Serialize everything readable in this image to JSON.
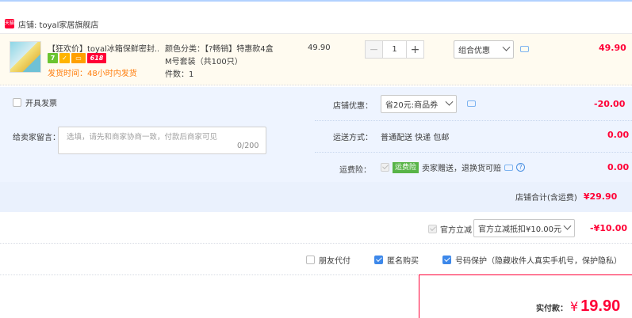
{
  "store": {
    "badge": "天猫",
    "label": "店铺: toyal家居旗舰店"
  },
  "item": {
    "title": "【狂欢价】toyal冰箱保鲜密封...",
    "badges": [
      "7",
      "",
      "",
      "618"
    ],
    "ship_time": "发货时间：48小时内发货",
    "spec_color": "颜色分类：【?畅销】特惠款4盒",
    "spec_size": "M号套装（共100只）",
    "spec_count": "件数：1",
    "unit_price": "49.90",
    "quantity": "1",
    "promo_select": "组合优惠",
    "total": "49.90"
  },
  "options": {
    "invoice_label": "开具发票",
    "message_label": "给卖家留言：",
    "message_placeholder": "选填，请先和商家协商一致，付款后商家可见",
    "message_count": "0/200",
    "shop_discount_label": "店铺优惠：",
    "shop_discount_select": "省20元:商品券",
    "shop_discount_amount": "-20.00",
    "shipping_label": "运送方式：",
    "shipping_value": "普通配送 快递 包邮",
    "shipping_amount": "0.00",
    "freight_ins_label": "运费险：",
    "freight_ins_tag": "运费险",
    "freight_ins_text": "卖家赠送，退换货可赔",
    "freight_ins_amount": "0.00",
    "subtotal_label": "店铺合计(含运费)",
    "subtotal_amount": "¥29.90"
  },
  "official": {
    "label": "官方立减",
    "select": "官方立减抵扣¥10.00元",
    "amount": "-¥10.00"
  },
  "extras": {
    "friend_pay": "朋友代付",
    "anonymous": "匿名购买",
    "number_protect": "号码保护（隐藏收件人真实手机号，保护隐私）",
    "anonymous_checked": true,
    "number_protect_checked": true
  },
  "payment": {
    "label": "实付款：",
    "currency": "¥",
    "amount": "19.90"
  },
  "colors": {
    "accent_red": "#ff0036",
    "panel_blue": "#eef4ff",
    "check_blue": "#3d88ea",
    "ship_orange": "#ff7d0c"
  }
}
